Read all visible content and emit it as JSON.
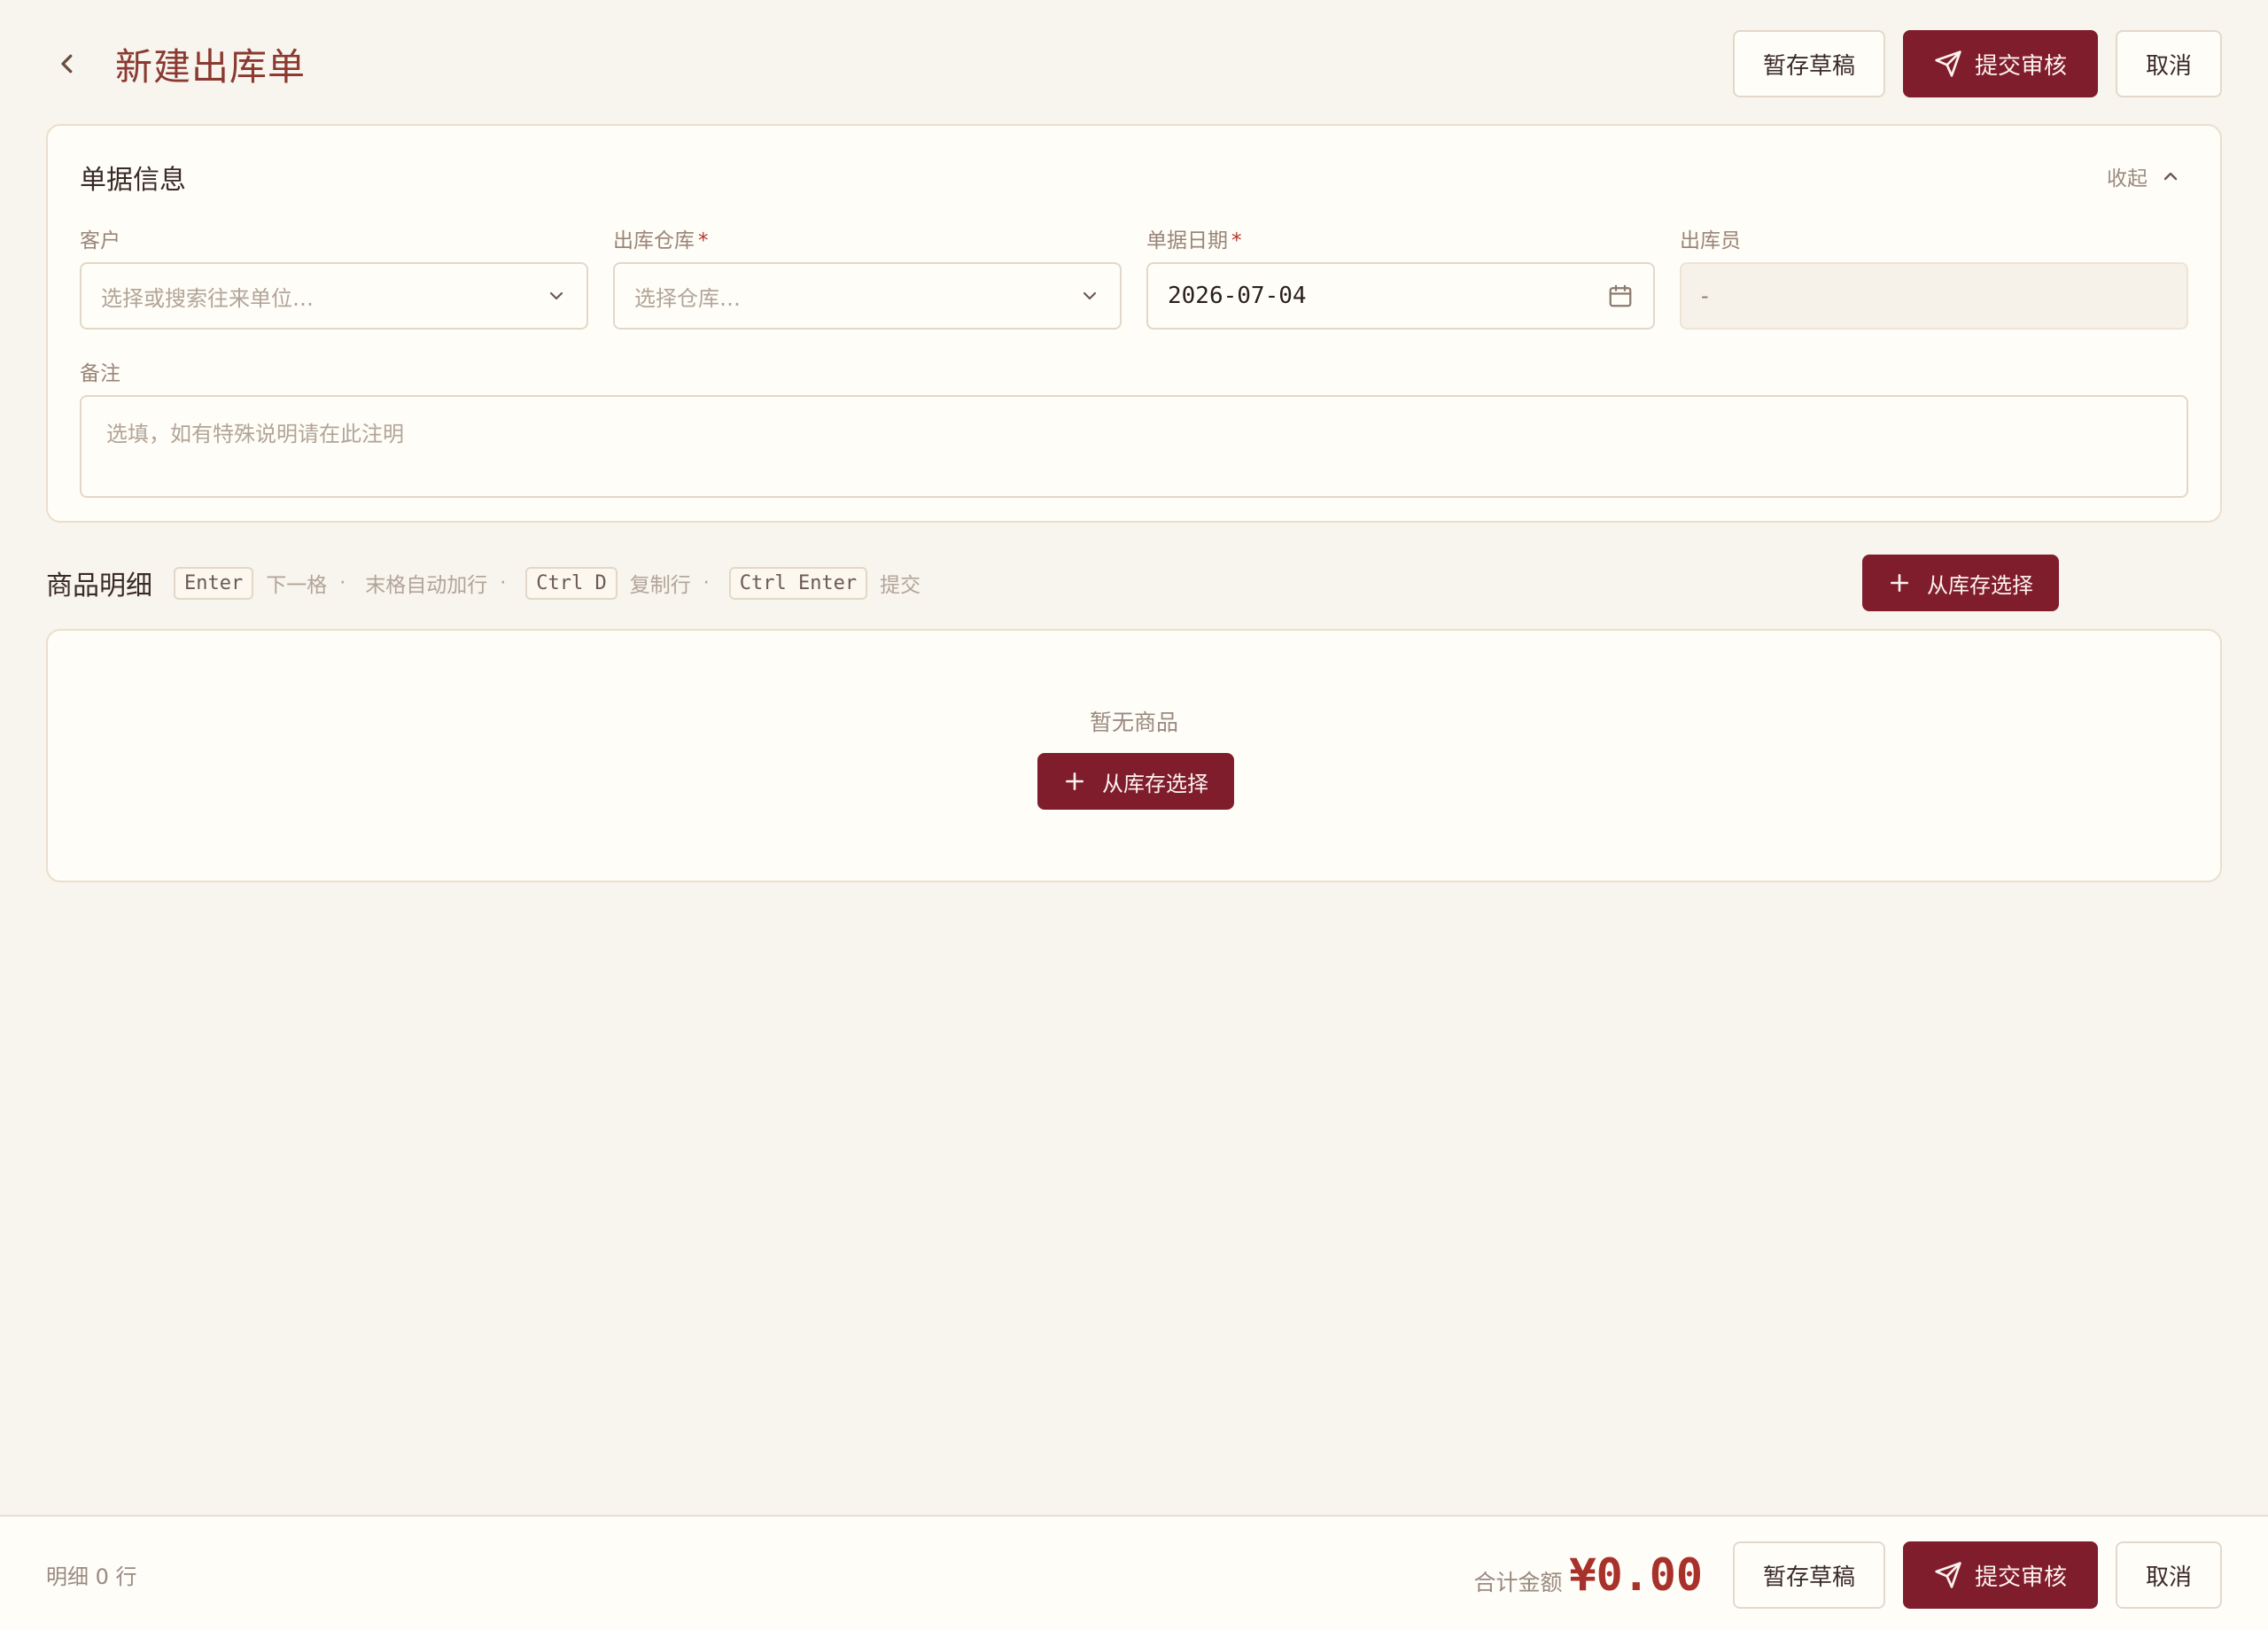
{
  "header": {
    "title": "新建出库单",
    "draft_label": "暂存草稿",
    "submit_label": "提交审核",
    "cancel_label": "取消"
  },
  "info": {
    "title": "单据信息",
    "collapse_label": "收起",
    "customer": {
      "label": "客户",
      "placeholder": "选择或搜索往来单位…"
    },
    "warehouse": {
      "label": "出库仓库",
      "required": "*",
      "placeholder": "选择仓库…"
    },
    "date": {
      "label": "单据日期",
      "required": "*",
      "value": "2026-07-04"
    },
    "operator": {
      "label": "出库员",
      "value": "-"
    },
    "remark": {
      "label": "备注",
      "placeholder": "选填，如有特殊说明请在此注明"
    }
  },
  "items": {
    "title": "商品明细",
    "shortcuts": {
      "enter_key": "Enter",
      "enter_hint_1": "下一格",
      "enter_hint_2": "末格自动加行",
      "ctrl_d_key": "Ctrl D",
      "ctrl_d_hint": "复制行",
      "ctrl_enter_key": "Ctrl Enter",
      "ctrl_enter_hint": "提交",
      "separator": "·"
    },
    "pick_label": "从库存选择",
    "empty_text": "暂无商品"
  },
  "footer": {
    "count_text": "明细 0 行",
    "total_label": "合计金额",
    "total_value": "¥0.00",
    "draft_label": "暂存草稿",
    "submit_label": "提交审核",
    "cancel_label": "取消"
  },
  "colors": {
    "primary": "#7f1d2d",
    "title": "#8a3a30",
    "total": "#a8322b",
    "background": "#f8f4ee"
  }
}
